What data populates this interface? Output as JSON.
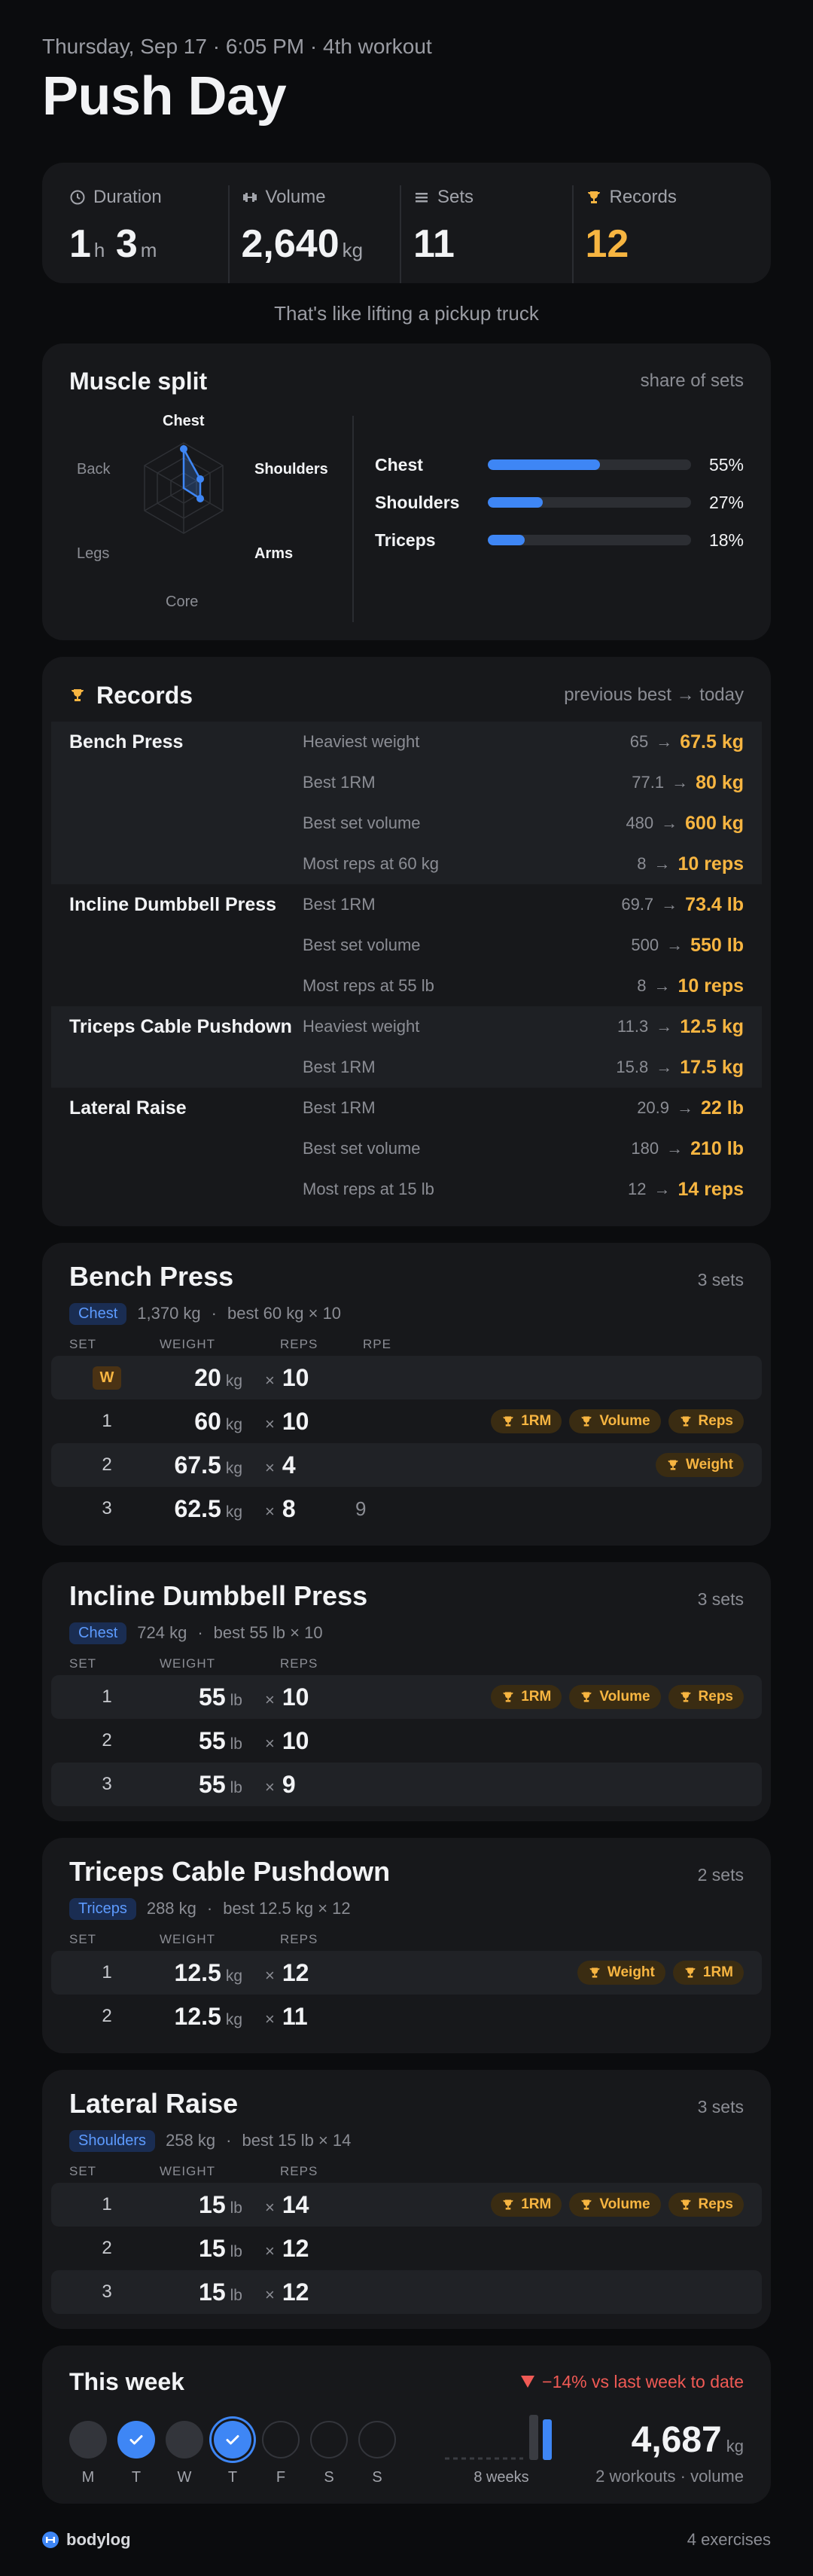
{
  "header": {
    "subtitle": "Thursday, Sep 17 · 6:05 PM · 4th workout",
    "title": "Push Day"
  },
  "summary": {
    "duration_label": "Duration",
    "duration_h": "1",
    "duration_h_unit": "h",
    "duration_m": "3",
    "duration_m_unit": "m",
    "volume_label": "Volume",
    "volume_value": "2,640",
    "volume_unit": "kg",
    "sets_label": "Sets",
    "sets_value": "11",
    "records_label": "Records",
    "records_value": "12",
    "tagline": "That's like lifting a pickup truck"
  },
  "muscle_split": {
    "title": "Muscle split",
    "note": "share of sets",
    "radar_labels": {
      "chest": "Chest",
      "shoulders": "Shoulders",
      "arms": "Arms",
      "core": "Core",
      "legs": "Legs",
      "back": "Back"
    },
    "bars": [
      {
        "name": "Chest",
        "pct_label": "55%",
        "fraction": 0.55
      },
      {
        "name": "Shoulders",
        "pct_label": "27%",
        "fraction": 0.27
      },
      {
        "name": "Triceps",
        "pct_label": "18%",
        "fraction": 0.18
      }
    ]
  },
  "records": {
    "title": "Records",
    "note": "previous best → today",
    "groups": [
      {
        "exercise": "Bench Press",
        "lines": [
          {
            "what": "Heaviest weight",
            "old": "65",
            "new": "67.5 kg"
          },
          {
            "what": "Best 1RM",
            "old": "77.1",
            "new": "80 kg"
          },
          {
            "what": "Best set volume",
            "old": "480",
            "new": "600 kg"
          },
          {
            "what": "Most reps at 60 kg",
            "old": "8",
            "new": "10 reps"
          }
        ]
      },
      {
        "exercise": "Incline Dumbbell Press",
        "lines": [
          {
            "what": "Best 1RM",
            "old": "69.7",
            "new": "73.4 lb"
          },
          {
            "what": "Best set volume",
            "old": "500",
            "new": "550 lb"
          },
          {
            "what": "Most reps at 55 lb",
            "old": "8",
            "new": "10 reps"
          }
        ]
      },
      {
        "exercise": "Triceps Cable Pushdown",
        "lines": [
          {
            "what": "Heaviest weight",
            "old": "11.3",
            "new": "12.5 kg"
          },
          {
            "what": "Best 1RM",
            "old": "15.8",
            "new": "17.5 kg"
          }
        ]
      },
      {
        "exercise": "Lateral Raise",
        "lines": [
          {
            "what": "Best 1RM",
            "old": "20.9",
            "new": "22 lb"
          },
          {
            "what": "Best set volume",
            "old": "180",
            "new": "210 lb"
          },
          {
            "what": "Most reps at 15 lb",
            "old": "12",
            "new": "14 reps"
          }
        ]
      }
    ]
  },
  "columns": {
    "set": "SET",
    "weight": "WEIGHT",
    "reps": "REPS",
    "rpe": "RPE"
  },
  "exercises": [
    {
      "name": "Bench Press",
      "sets_label": "3 sets",
      "muscle": "Chest",
      "volume": "1,370 kg",
      "best": "best 60 kg × 10",
      "rows": [
        {
          "set": "W",
          "weight": "20",
          "unit": "kg",
          "reps": "10",
          "rpe": "",
          "badges": []
        },
        {
          "set": "1",
          "weight": "60",
          "unit": "kg",
          "reps": "10",
          "rpe": "",
          "badges": [
            "1RM",
            "Volume",
            "Reps"
          ]
        },
        {
          "set": "2",
          "weight": "67.5",
          "unit": "kg",
          "reps": "4",
          "rpe": "",
          "badges": [
            "Weight"
          ]
        },
        {
          "set": "3",
          "weight": "62.5",
          "unit": "kg",
          "reps": "8",
          "rpe": "9",
          "badges": []
        }
      ]
    },
    {
      "name": "Incline Dumbbell Press",
      "sets_label": "3 sets",
      "muscle": "Chest",
      "volume": "724 kg",
      "best": "best 55 lb × 10",
      "rows": [
        {
          "set": "1",
          "weight": "55",
          "unit": "lb",
          "reps": "10",
          "rpe": "",
          "badges": [
            "1RM",
            "Volume",
            "Reps"
          ]
        },
        {
          "set": "2",
          "weight": "55",
          "unit": "lb",
          "reps": "10",
          "rpe": "",
          "badges": []
        },
        {
          "set": "3",
          "weight": "55",
          "unit": "lb",
          "reps": "9",
          "rpe": "",
          "badges": []
        }
      ]
    },
    {
      "name": "Triceps Cable Pushdown",
      "sets_label": "2 sets",
      "muscle": "Triceps",
      "volume": "288 kg",
      "best": "best 12.5 kg × 12",
      "rows": [
        {
          "set": "1",
          "weight": "12.5",
          "unit": "kg",
          "reps": "12",
          "rpe": "",
          "badges": [
            "Weight",
            "1RM"
          ]
        },
        {
          "set": "2",
          "weight": "12.5",
          "unit": "kg",
          "reps": "11",
          "rpe": "",
          "badges": []
        }
      ]
    },
    {
      "name": "Lateral Raise",
      "sets_label": "3 sets",
      "muscle": "Shoulders",
      "volume": "258 kg",
      "best": "best 15 lb × 14",
      "rows": [
        {
          "set": "1",
          "weight": "15",
          "unit": "lb",
          "reps": "14",
          "rpe": "",
          "badges": [
            "1RM",
            "Volume",
            "Reps"
          ]
        },
        {
          "set": "2",
          "weight": "15",
          "unit": "lb",
          "reps": "12",
          "rpe": "",
          "badges": []
        },
        {
          "set": "3",
          "weight": "15",
          "unit": "lb",
          "reps": "12",
          "rpe": "",
          "badges": []
        }
      ]
    }
  ],
  "week": {
    "title": "This week",
    "delta": "−14% vs last week to date",
    "days": [
      {
        "label": "M",
        "state": "rest"
      },
      {
        "label": "T",
        "state": "done"
      },
      {
        "label": "W",
        "state": "rest"
      },
      {
        "label": "T",
        "state": "today"
      },
      {
        "label": "F",
        "state": "empty"
      },
      {
        "label": "S",
        "state": "empty"
      },
      {
        "label": "S",
        "state": "empty"
      }
    ],
    "trend_caption": "8 weeks",
    "total_value": "4,687",
    "total_unit": "kg",
    "total_caption": "2 workouts · volume"
  },
  "footer": {
    "brand": "bodylog",
    "count": "4 exercises"
  },
  "colors": {
    "accent": "#3e86f5",
    "gold": "#f7b541",
    "down": "#f05a55"
  }
}
